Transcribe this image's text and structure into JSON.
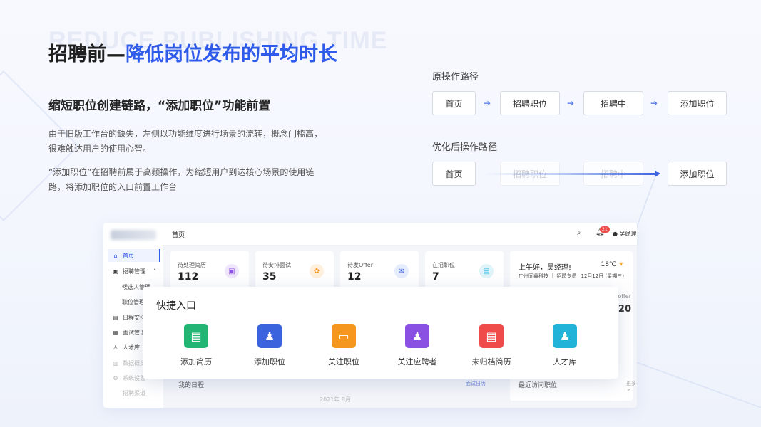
{
  "header": {
    "bg_title": "REDUCE PUBLISHING TIME",
    "title_prefix": "招聘前—",
    "title_highlight": "降低岗位发布的平均时长"
  },
  "section": {
    "subtitle": "缩短职位创建链路，“添加职位”功能前置",
    "para1": "由于旧版工作台的缺失，左侧以功能维度进行场景的流转，概念门槛高，很难触达用户的使用心智。",
    "para2": "“添加职位”在招聘前属于高频操作，为缩短用户到达核心场景的使用链路，将添加职位的入口前置工作台"
  },
  "original_path": {
    "label": "原操作路径",
    "steps": [
      "首页",
      "招聘职位",
      "招聘中",
      "添加职位"
    ]
  },
  "optimized_path": {
    "label": "优化后操作路径",
    "steps": [
      "首页",
      "招聘职位",
      "招聘中",
      "添加职位"
    ]
  },
  "app": {
    "page_title": "首页",
    "notification_count": "21",
    "user_name": "吴经理",
    "sidebar": {
      "items": [
        "首页",
        "招聘管理",
        "日程安排",
        "面试管理",
        "人才库",
        "数据概览",
        "系统设置",
        "招聘渠道"
      ],
      "sub_items": [
        "候选人管理",
        "职位管理"
      ]
    },
    "stats": [
      {
        "label": "待处理简历",
        "value": "112"
      },
      {
        "label": "待安排面试",
        "value": "35"
      },
      {
        "label": "待发Offer",
        "value": "12"
      },
      {
        "label": "在招职位",
        "value": "7"
      }
    ],
    "greeting": {
      "hello": "上午好，吴经理!",
      "company": "广州同鑫科技 ｜ 招聘专员",
      "temperature": "18℃",
      "date": "12月12日 (星期三)",
      "offer_label": "送offer",
      "offer_value": "20"
    },
    "schedule_title": "我的日程",
    "schedule_button": "面试日历",
    "recent_title": "最近访问职位",
    "recent_more": "更多 >",
    "month": "2021年 8月"
  },
  "quick": {
    "title": "快捷入口",
    "items": [
      {
        "label": "添加简历",
        "color": "#22b573"
      },
      {
        "label": "添加职位",
        "color": "#3a63dd"
      },
      {
        "label": "关注职位",
        "color": "#f5961f"
      },
      {
        "label": "关注应聘者",
        "color": "#8a4fe3"
      },
      {
        "label": "未归档简历",
        "color": "#ef4b4b"
      },
      {
        "label": "人才库",
        "color": "#22b4d8"
      }
    ]
  }
}
